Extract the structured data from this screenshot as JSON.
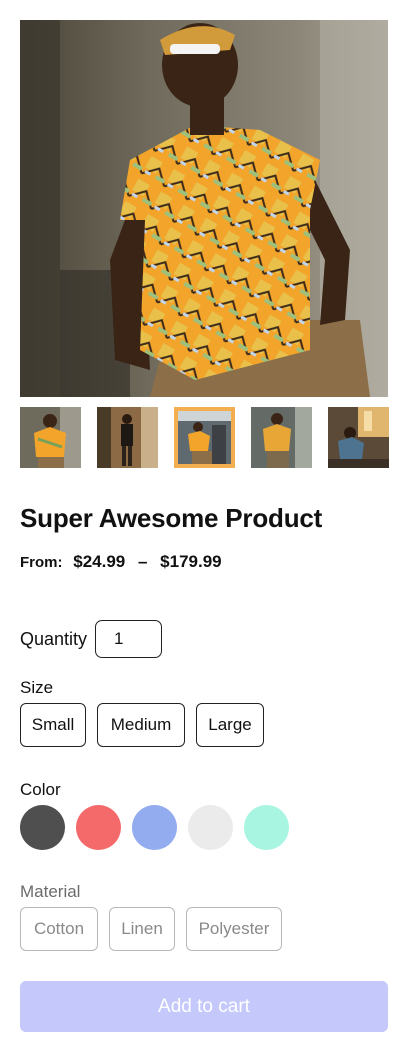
{
  "product": {
    "title": "Super Awesome Product",
    "price_prefix": "From:",
    "price_min": "$24.99",
    "price_separator": "–",
    "price_max": "$179.99"
  },
  "gallery": {
    "selected_index": 2,
    "accent_color": "#f2ae4f",
    "thumb_count": 5
  },
  "quantity": {
    "label": "Quantity",
    "value": "1"
  },
  "size": {
    "label": "Size",
    "options": [
      "Small",
      "Medium",
      "Large"
    ]
  },
  "color": {
    "label": "Color",
    "swatches": [
      "#4f4f4f",
      "#f46a6a",
      "#93acf0",
      "#ebebeb",
      "#a8f5e1"
    ]
  },
  "material": {
    "label": "Material",
    "options": [
      "Cotton",
      "Linen",
      "Polyester"
    ],
    "disabled": true
  },
  "cart": {
    "label": "Add to cart",
    "background": "#c4c8fb",
    "disabled": true
  }
}
